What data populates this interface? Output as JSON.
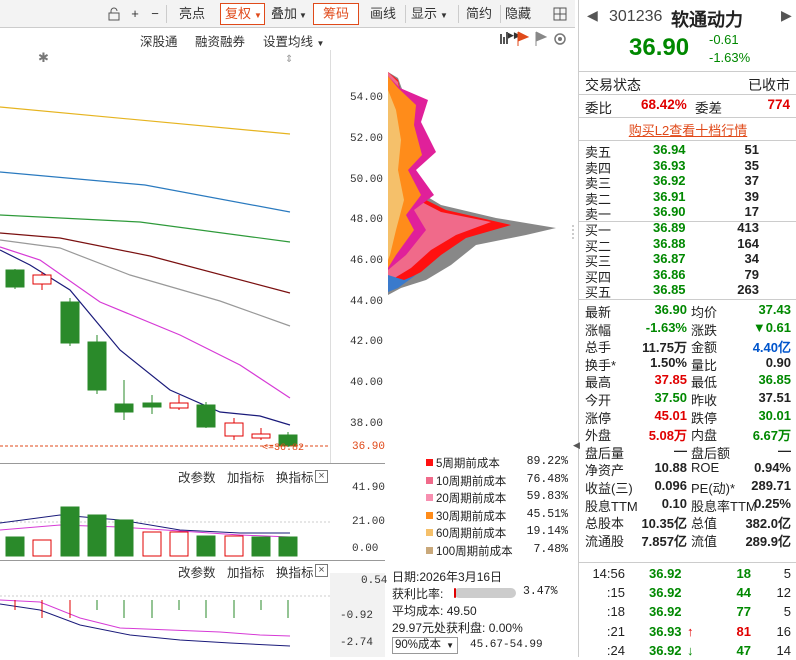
{
  "toolbar": {
    "items": [
      "亮点",
      "复权",
      "叠加",
      "筹码",
      "画线",
      "显示",
      "简约",
      "隐藏"
    ]
  },
  "subbar": {
    "items": [
      "深股通",
      "融资融券",
      "设置均线"
    ]
  },
  "price_axis": [
    "54.00",
    "52.00",
    "50.00",
    "48.00",
    "46.00",
    "44.00",
    "42.00",
    "40.00",
    "38.00",
    "36.90"
  ],
  "price_marker": "<=36.82",
  "volume_panel": {
    "buttons": [
      "改参数",
      "加指标",
      "换指标"
    ],
    "axis": [
      "41.90",
      "21.00",
      "0.00"
    ]
  },
  "macd_panel": {
    "buttons": [
      "改参数",
      "加指标",
      "换指标"
    ],
    "axis": [
      "0.54",
      "-0.92",
      "-2.74"
    ]
  },
  "chip_legend": [
    {
      "label": "5周期前成本",
      "value": "89.22%",
      "color": "#ff1010"
    },
    {
      "label": "10周期前成本",
      "value": "76.48%",
      "color": "#f06a8a"
    },
    {
      "label": "20周期前成本",
      "value": "59.83%",
      "color": "#f78fb0"
    },
    {
      "label": "30周期前成本",
      "value": "45.51%",
      "color": "#ff8c1a"
    },
    {
      "label": "60周期前成本",
      "value": "19.14%",
      "color": "#f5c06a"
    },
    {
      "label": "100周期前成本",
      "value": "7.48%",
      "color": "#c9a87a"
    }
  ],
  "chip_info": {
    "date_label": "日期:",
    "date": "2026年3月16日",
    "profit_label": "获利比率:",
    "profit_ratio": "3.47%",
    "avg_label": "平均成本:",
    "avg_cost": "49.50",
    "profit_at_label": "29.97元处获利盘:",
    "profit_at": "0.00%",
    "cost_select": "90%成本",
    "cost_range": "45.67-54.99"
  },
  "stock": {
    "code": "301236",
    "name": "软通动力",
    "price": "36.90",
    "change": "-0.61",
    "change_pct": "-1.63%"
  },
  "trade_status": {
    "label": "交易状态",
    "value": "已收市"
  },
  "weibi": {
    "label1": "委比",
    "value1": "68.42%",
    "label2": "委差",
    "value2": "774"
  },
  "l2_link": "购买L2查看十档行情",
  "asks": [
    {
      "label": "卖五",
      "price": "36.94",
      "vol": "51"
    },
    {
      "label": "卖四",
      "price": "36.93",
      "vol": "35"
    },
    {
      "label": "卖三",
      "price": "36.92",
      "vol": "37"
    },
    {
      "label": "卖二",
      "price": "36.91",
      "vol": "39"
    },
    {
      "label": "卖一",
      "price": "36.90",
      "vol": "17"
    }
  ],
  "bids": [
    {
      "label": "买一",
      "price": "36.89",
      "vol": "413"
    },
    {
      "label": "买二",
      "price": "36.88",
      "vol": "164"
    },
    {
      "label": "买三",
      "price": "36.87",
      "vol": "34"
    },
    {
      "label": "买四",
      "price": "36.86",
      "vol": "79"
    },
    {
      "label": "买五",
      "price": "36.85",
      "vol": "263"
    }
  ],
  "quote": [
    {
      "l1": "最新",
      "v1": "36.90",
      "c1": "grn",
      "l2": "均价",
      "v2": "37.43",
      "c2": "grn"
    },
    {
      "l1": "涨幅",
      "v1": "-1.63%",
      "c1": "grn",
      "l2": "涨跌",
      "v2": "▼0.61",
      "c2": "grn"
    },
    {
      "l1": "总手",
      "v1": "11.75万",
      "c1": "",
      "l2": "金额",
      "v2": "4.40亿",
      "c2": "blu"
    },
    {
      "l1": "换手*",
      "v1": "1.50%",
      "c1": "",
      "l2": "量比",
      "v2": "0.90",
      "c2": ""
    },
    {
      "l1": "最高",
      "v1": "37.85",
      "c1": "red",
      "l2": "最低",
      "v2": "36.85",
      "c2": "grn"
    },
    {
      "l1": "今开",
      "v1": "37.50",
      "c1": "grn",
      "l2": "昨收",
      "v2": "37.51",
      "c2": ""
    },
    {
      "l1": "涨停",
      "v1": "45.01",
      "c1": "red",
      "l2": "跌停",
      "v2": "30.01",
      "c2": "grn"
    },
    {
      "l1": "外盘",
      "v1": "5.08万",
      "c1": "red",
      "l2": "内盘",
      "v2": "6.67万",
      "c2": "grn"
    },
    {
      "l1": "盘后量",
      "v1": "—",
      "c1": "",
      "l2": "盘后额",
      "v2": "—",
      "c2": ""
    },
    {
      "l1": "净资产",
      "v1": "10.88",
      "c1": "",
      "l2": "ROE",
      "v2": "0.94%",
      "c2": ""
    },
    {
      "l1": "收益(三)",
      "v1": "0.096",
      "c1": "",
      "l2": "PE(动)*",
      "v2": "289.71",
      "c2": ""
    },
    {
      "l1": "股息TTM",
      "v1": "0.10",
      "c1": "",
      "l2": "股息率TTM",
      "v2": "0.25%",
      "c2": ""
    },
    {
      "l1": "总股本",
      "v1": "10.35亿",
      "c1": "",
      "l2": "总值",
      "v2": "382.0亿",
      "c2": ""
    },
    {
      "l1": "流通股",
      "v1": "7.857亿",
      "c1": "",
      "l2": "流值",
      "v2": "289.9亿",
      "c2": ""
    }
  ],
  "ticks": [
    {
      "time": "14:56",
      "price": "36.92",
      "vol": "18",
      "n": "5",
      "dir": "",
      "vc": "grn"
    },
    {
      "time": ":15",
      "price": "36.92",
      "vol": "44",
      "n": "12",
      "dir": "",
      "vc": "grn"
    },
    {
      "time": ":18",
      "price": "36.92",
      "vol": "77",
      "n": "5",
      "dir": "",
      "vc": "grn"
    },
    {
      "time": ":21",
      "price": "36.93",
      "vol": "81",
      "n": "16",
      "dir": "↑",
      "vc": "red"
    },
    {
      "time": ":24",
      "price": "36.92",
      "vol": "47",
      "n": "14",
      "dir": "↓",
      "vc": "grn"
    }
  ],
  "colors": {
    "up": "#e00000",
    "down": "#008800",
    "accent": "#e04a1a"
  }
}
